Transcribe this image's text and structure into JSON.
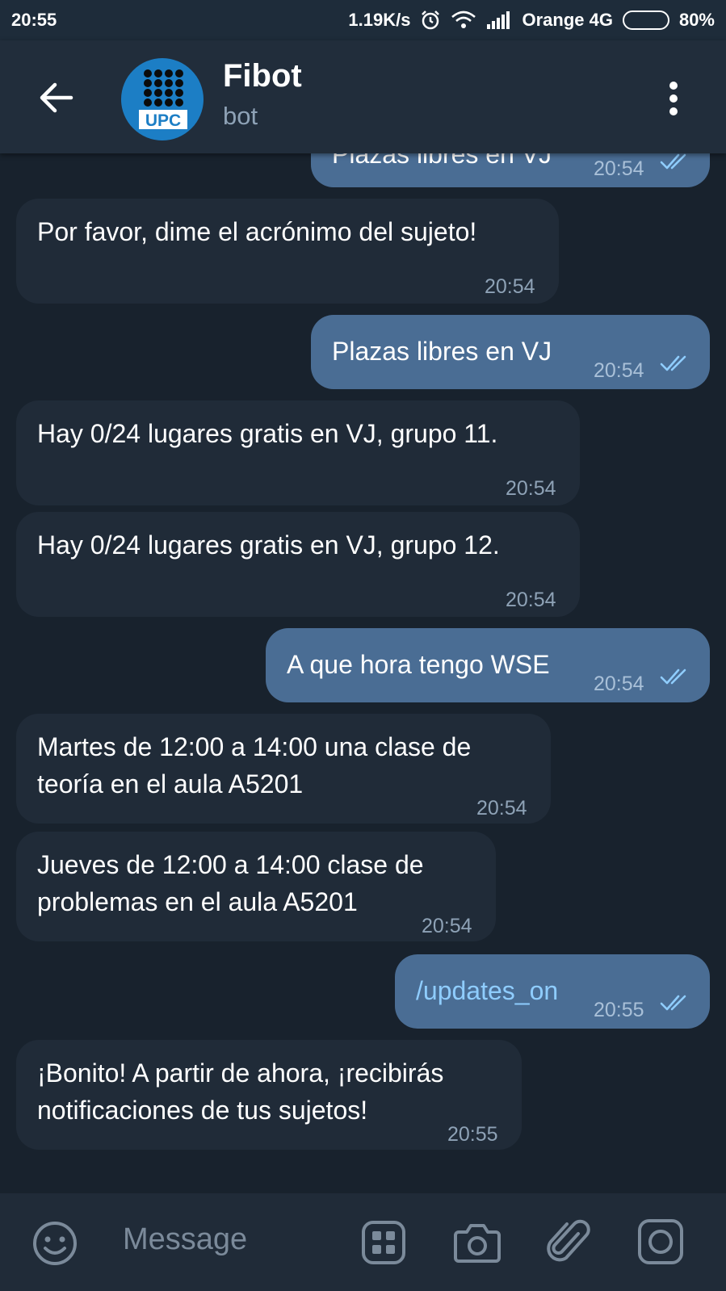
{
  "status_bar": {
    "time": "20:55",
    "speed": "1.19K/s",
    "carrier": "Orange 4G",
    "battery": "80%",
    "battery_level": 0.8
  },
  "header": {
    "avatar_text": "UPC",
    "title": "Fibot",
    "subtitle": "bot"
  },
  "messages": [
    {
      "dir": "out",
      "text": "Plazas libres en VJ",
      "time": "20:54"
    },
    {
      "dir": "in",
      "text": "Por favor, dime el acrónimo del sujeto!",
      "time": "20:54"
    },
    {
      "dir": "out",
      "text": "Plazas libres en VJ",
      "time": "20:54"
    },
    {
      "dir": "in",
      "text": "Hay 0/24 lugares gratis en VJ, grupo 11.",
      "time": "20:54"
    },
    {
      "dir": "in",
      "text": "Hay 0/24 lugares gratis en VJ, grupo 12.",
      "time": "20:54"
    },
    {
      "dir": "out",
      "text": "A que hora tengo WSE",
      "time": "20:54"
    },
    {
      "dir": "in",
      "text_line1": "Martes de 12:00 a 14:00 una clase de",
      "text_line2": "teoría en el aula A5201",
      "time": "20:54"
    },
    {
      "dir": "in",
      "text_line1": "Jueves de 12:00 a 14:00 clase de",
      "text_line2": "problemas en el aula A5201",
      "time": "20:54"
    },
    {
      "dir": "out",
      "text": "/updates_on",
      "time": "20:55"
    },
    {
      "dir": "in",
      "text_line1": "¡Bonito! A partir de ahora, ¡recibirás",
      "text_line2": "notificaciones de tus sujetos!",
      "time": "20:55"
    }
  ],
  "input": {
    "placeholder": "Message"
  },
  "icons": {
    "back": "arrow-left-icon",
    "menu": "more-vertical-icon",
    "emoji": "emoji-icon",
    "bot_keyboard": "bot-keyboard-icon",
    "camera": "camera-icon",
    "attach": "paperclip-icon",
    "video_message": "round-video-icon"
  },
  "colors": {
    "background": "#18222d",
    "header": "#212d3b",
    "incoming_bubble": "#202b38",
    "outgoing_bubble": "#4a6d94",
    "check_marks": "#8fcdff",
    "battery": "#f7a320"
  }
}
